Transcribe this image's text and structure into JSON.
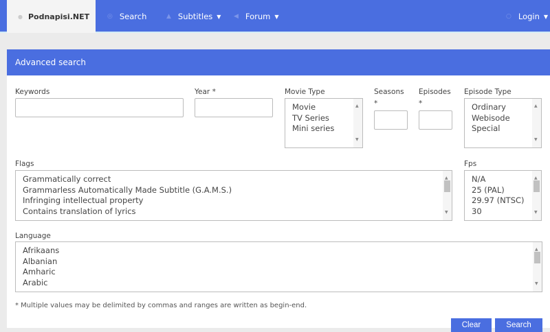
{
  "nav": {
    "brand": "Podnapisi.NET",
    "items": [
      {
        "label": "Search"
      },
      {
        "label": "Subtitles"
      },
      {
        "label": "Forum"
      }
    ],
    "login": "Login"
  },
  "panel": {
    "title": "Advanced search"
  },
  "form": {
    "keywords": {
      "label": "Keywords",
      "value": ""
    },
    "year": {
      "label": "Year *",
      "value": ""
    },
    "movie_type": {
      "label": "Movie Type",
      "options": [
        "Movie",
        "TV Series",
        "Mini series"
      ]
    },
    "seasons": {
      "label": "Seasons",
      "star": "*",
      "value": ""
    },
    "episodes": {
      "label": "Episodes",
      "star": "*",
      "value": ""
    },
    "episode_type": {
      "label": "Episode Type",
      "options": [
        "Ordinary",
        "Webisode",
        "Special"
      ]
    },
    "flags": {
      "label": "Flags",
      "options": [
        "Grammatically correct",
        "Grammarless Automatically Made Subtitle (G.A.M.S.)",
        "Infringing intellectual property",
        "Contains translation of lyrics"
      ]
    },
    "fps": {
      "label": "Fps",
      "options": [
        "N/A",
        "25 (PAL)",
        "29.97 (NTSC)",
        "30"
      ]
    },
    "language": {
      "label": "Language",
      "options": [
        "Afrikaans",
        "Albanian",
        "Amharic",
        "Arabic"
      ]
    },
    "note": "* Multiple values may be delimited by commas and ranges are written as begin-end.",
    "clear_label": "Clear",
    "search_label": "Search"
  }
}
